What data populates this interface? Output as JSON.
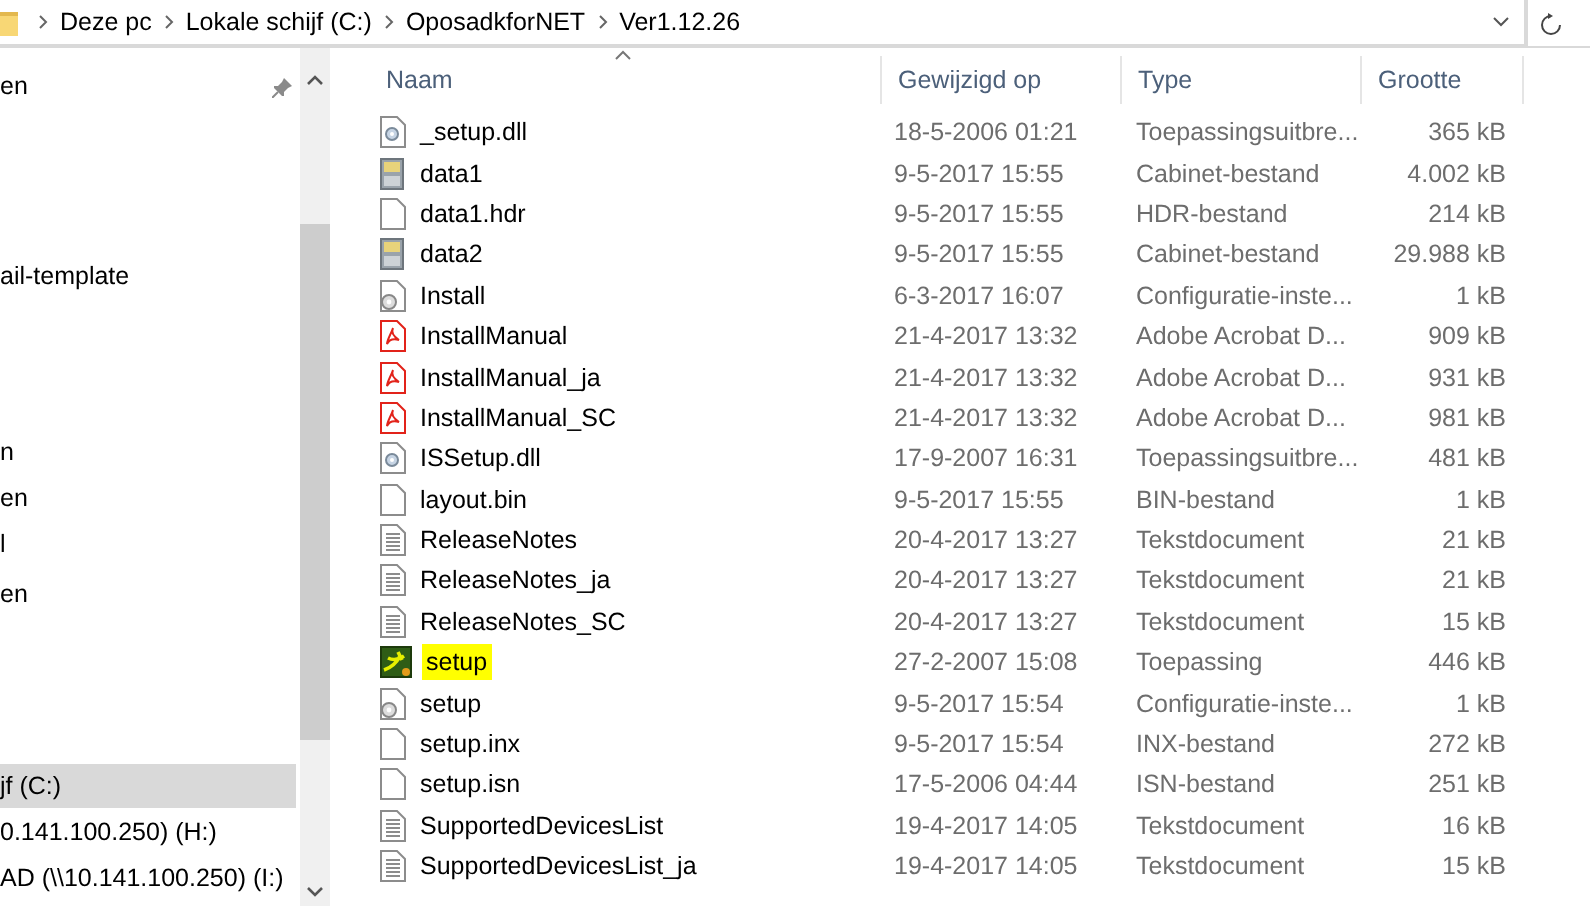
{
  "address_bar": {
    "crumbs": [
      "Deze pc",
      "Lokale schijf (C:)",
      "OposadkforNET",
      "Ver1.12.26"
    ]
  },
  "navigation_pane": {
    "items": [
      {
        "label": "en",
        "selected": false
      },
      {
        "label": "ail-template",
        "selected": false
      },
      {
        "label": "n",
        "selected": false
      },
      {
        "label": "en",
        "selected": false
      },
      {
        "label": "l",
        "selected": false
      },
      {
        "label": "en",
        "selected": false
      },
      {
        "label": "jf (C:)",
        "selected": true
      },
      {
        "label": "0.141.100.250) (H:)",
        "selected": false
      },
      {
        "label": "AD (\\\\10.141.100.250) (I:)",
        "selected": false
      }
    ]
  },
  "file_list": {
    "columns": [
      "Naam",
      "Gewijzigd op",
      "Type",
      "Grootte"
    ],
    "rows": [
      {
        "kind": "dll",
        "name": "_setup.dll",
        "modified": "18-5-2006 01:21",
        "type": "Toepassingsuitbre...",
        "size": "365 kB",
        "highlighted": false
      },
      {
        "kind": "cabinet",
        "name": "data1",
        "modified": "9-5-2017 15:55",
        "type": "Cabinet-bestand",
        "size": "4.002 kB",
        "highlighted": false
      },
      {
        "kind": "blank",
        "name": "data1.hdr",
        "modified": "9-5-2017 15:55",
        "type": "HDR-bestand",
        "size": "214 kB",
        "highlighted": false
      },
      {
        "kind": "cabinet",
        "name": "data2",
        "modified": "9-5-2017 15:55",
        "type": "Cabinet-bestand",
        "size": "29.988 kB",
        "highlighted": false
      },
      {
        "kind": "config",
        "name": "Install",
        "modified": "6-3-2017 16:07",
        "type": "Configuratie-inste...",
        "size": "1 kB",
        "highlighted": false
      },
      {
        "kind": "pdf",
        "name": "InstallManual",
        "modified": "21-4-2017 13:32",
        "type": "Adobe Acrobat D...",
        "size": "909 kB",
        "highlighted": false
      },
      {
        "kind": "pdf",
        "name": "InstallManual_ja",
        "modified": "21-4-2017 13:32",
        "type": "Adobe Acrobat D...",
        "size": "931 kB",
        "highlighted": false
      },
      {
        "kind": "pdf",
        "name": "InstallManual_SC",
        "modified": "21-4-2017 13:32",
        "type": "Adobe Acrobat D...",
        "size": "981 kB",
        "highlighted": false
      },
      {
        "kind": "dll",
        "name": "ISSetup.dll",
        "modified": "17-9-2007 16:31",
        "type": "Toepassingsuitbre...",
        "size": "481 kB",
        "highlighted": false
      },
      {
        "kind": "blank",
        "name": "layout.bin",
        "modified": "9-5-2017 15:55",
        "type": "BIN-bestand",
        "size": "1 kB",
        "highlighted": false
      },
      {
        "kind": "text",
        "name": "ReleaseNotes",
        "modified": "20-4-2017 13:27",
        "type": "Tekstdocument",
        "size": "21 kB",
        "highlighted": false
      },
      {
        "kind": "text",
        "name": "ReleaseNotes_ja",
        "modified": "20-4-2017 13:27",
        "type": "Tekstdocument",
        "size": "21 kB",
        "highlighted": false
      },
      {
        "kind": "text",
        "name": "ReleaseNotes_SC",
        "modified": "20-4-2017 13:27",
        "type": "Tekstdocument",
        "size": "15 kB",
        "highlighted": false
      },
      {
        "kind": "app",
        "name": "setup",
        "modified": "27-2-2007 15:08",
        "type": "Toepassing",
        "size": "446 kB",
        "highlighted": true
      },
      {
        "kind": "config",
        "name": "setup",
        "modified": "9-5-2017 15:54",
        "type": "Configuratie-inste...",
        "size": "1 kB",
        "highlighted": false
      },
      {
        "kind": "blank",
        "name": "setup.inx",
        "modified": "9-5-2017 15:54",
        "type": "INX-bestand",
        "size": "272 kB",
        "highlighted": false
      },
      {
        "kind": "blank",
        "name": "setup.isn",
        "modified": "17-5-2006 04:44",
        "type": "ISN-bestand",
        "size": "251 kB",
        "highlighted": false
      },
      {
        "kind": "text",
        "name": "SupportedDevicesList",
        "modified": "19-4-2017 14:05",
        "type": "Tekstdocument",
        "size": "16 kB",
        "highlighted": false
      },
      {
        "kind": "text",
        "name": "SupportedDevicesList_ja",
        "modified": "19-4-2017 14:05",
        "type": "Tekstdocument",
        "size": "15 kB",
        "highlighted": false
      }
    ]
  }
}
